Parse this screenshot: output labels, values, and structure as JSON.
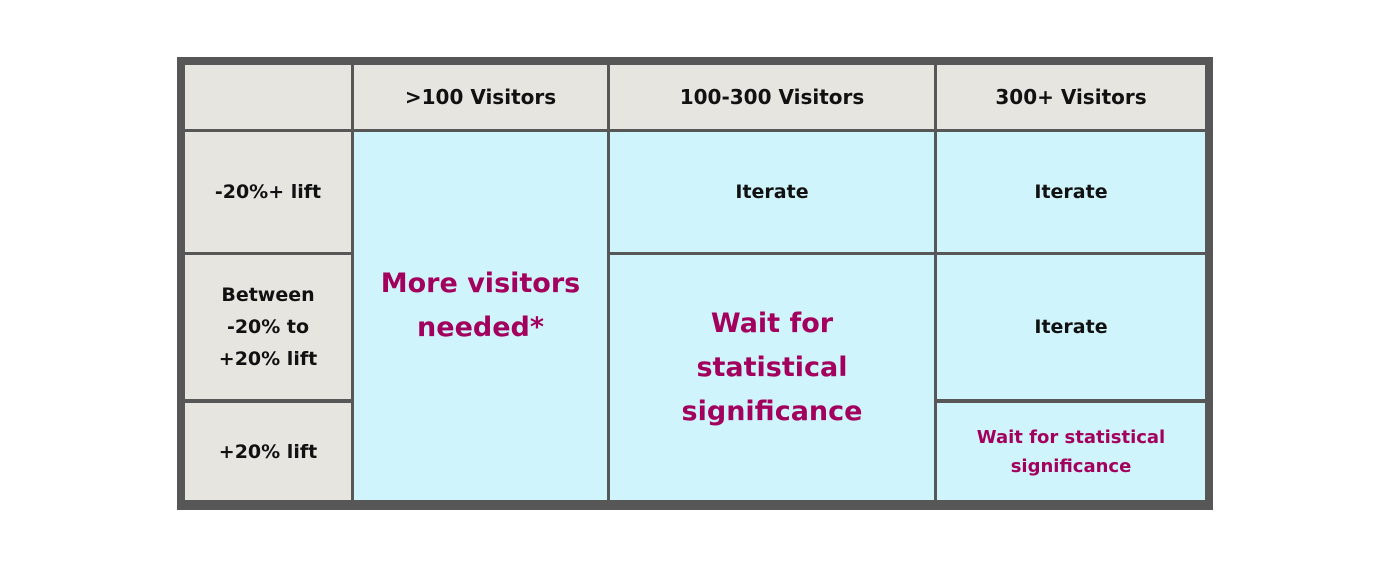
{
  "table": {
    "headers": [
      "",
      ">100 Visitors",
      "100-300 Visitors",
      "300+ Visitors"
    ],
    "row_labels": [
      "-20%+ lift",
      "Between -20% to +20% lift",
      "+20% lift"
    ],
    "row_label_lines": {
      "r0": "-20%+ lift",
      "r1": [
        "Between",
        "-20% to",
        "+20% lift"
      ],
      "r2": "+20% lift"
    },
    "cells": {
      "col1_merged": [
        "More visitors",
        "needed*"
      ],
      "col2_r0": "Iterate",
      "col2_merged": [
        "Wait for",
        "statistical",
        "significance"
      ],
      "col3_r0": "Iterate",
      "col3_r1": "Iterate",
      "col3_r2": [
        "Wait for statistical",
        "significance"
      ]
    },
    "colors": {
      "frame": "#575757",
      "header_bg": "#e6e5df",
      "cell_bg": "#d0f4fc",
      "accent_text": "#a3005e",
      "text": "#111111"
    }
  }
}
